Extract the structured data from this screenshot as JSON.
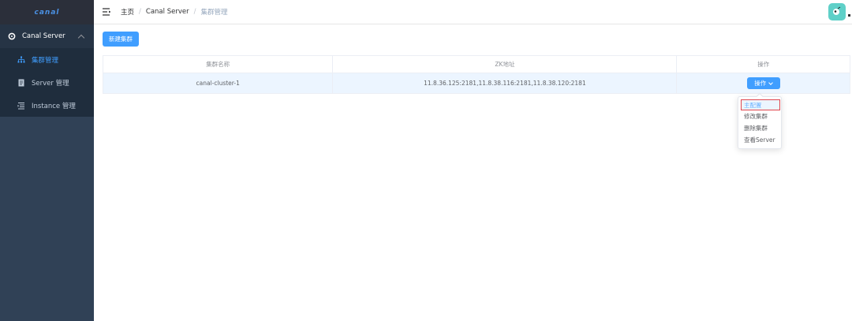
{
  "sidebar": {
    "logo": "canal",
    "parent": {
      "label": "Canal Server",
      "icon": "server-icon"
    },
    "items": [
      {
        "label": "集群管理",
        "icon": "cluster-icon",
        "active": true
      },
      {
        "label": "Server 管理",
        "icon": "server-doc-icon",
        "active": false
      },
      {
        "label": "Instance 管理",
        "icon": "list-icon",
        "active": false
      }
    ]
  },
  "header": {
    "breadcrumb": [
      "主页",
      "Canal Server",
      "集群管理"
    ]
  },
  "main": {
    "new_cluster_label": "新建集群",
    "table": {
      "columns": [
        "集群名称",
        "ZK地址",
        "操作"
      ],
      "rows": [
        {
          "name": "canal-cluster-1",
          "zk": "11.8.36.125:2181,11.8.38.116:2181,11.8.38.120:2181",
          "action_label": "操作"
        }
      ]
    },
    "dropdown": [
      "主配置",
      "修改集群",
      "删除集群",
      "查看Server"
    ]
  },
  "colors": {
    "primary": "#409eff",
    "sidebar_bg": "#304156",
    "highlight_border": "#e0464e"
  }
}
